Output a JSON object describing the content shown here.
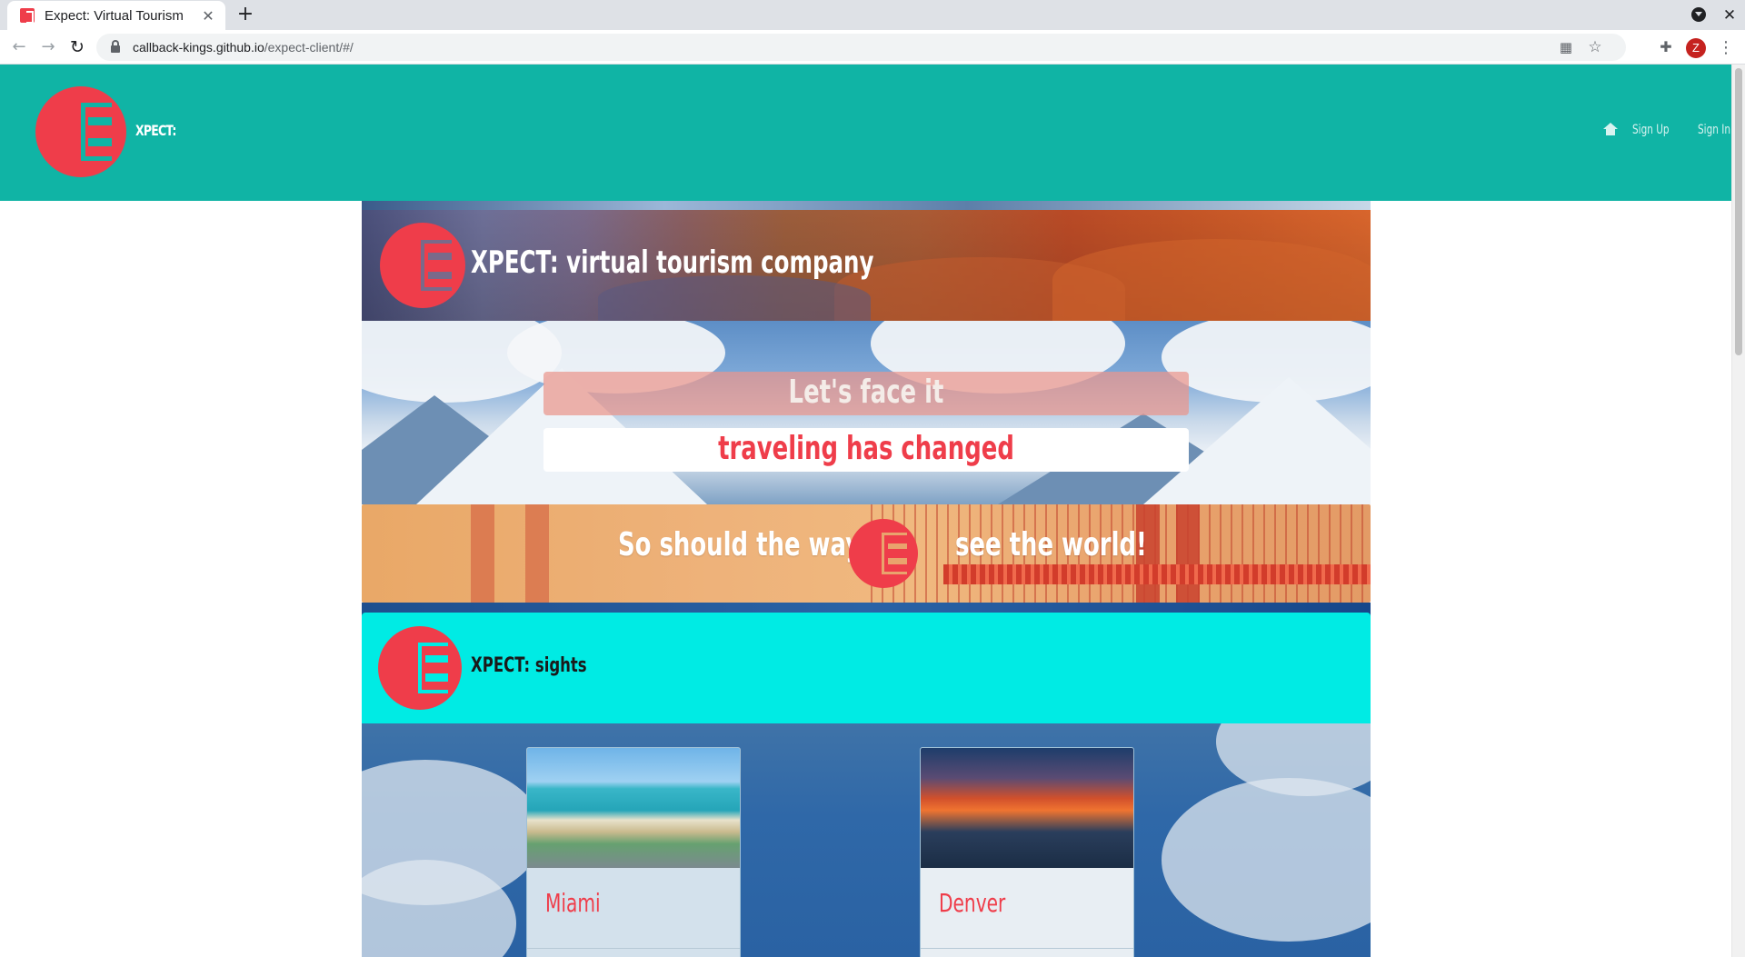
{
  "browser": {
    "tab_title": "Expect: Virtual Tourism",
    "tab_close_icon": "✕",
    "new_tab_icon": "+",
    "url_host": "callback-kings.github.io",
    "url_path": "/expect-client/#/",
    "profile_initial": "Z"
  },
  "header": {
    "brand": "XPECT:",
    "nav": {
      "sign_up": "Sign Up",
      "sign_in": "Sign In"
    },
    "background_color": "#10b4a5",
    "logo_color": "#ef3d4a"
  },
  "hero": {
    "title": "XPECT: virtual tourism company",
    "line_one": "Let's face it",
    "line_two": "traveling has changed",
    "line_three_before": "So should the way w",
    "line_three_after": "see the world!"
  },
  "sights": {
    "title": "XPECT: sights",
    "header_color": "#00ebe4",
    "cards": [
      {
        "name": "Miami"
      },
      {
        "name": "Denver"
      }
    ]
  }
}
